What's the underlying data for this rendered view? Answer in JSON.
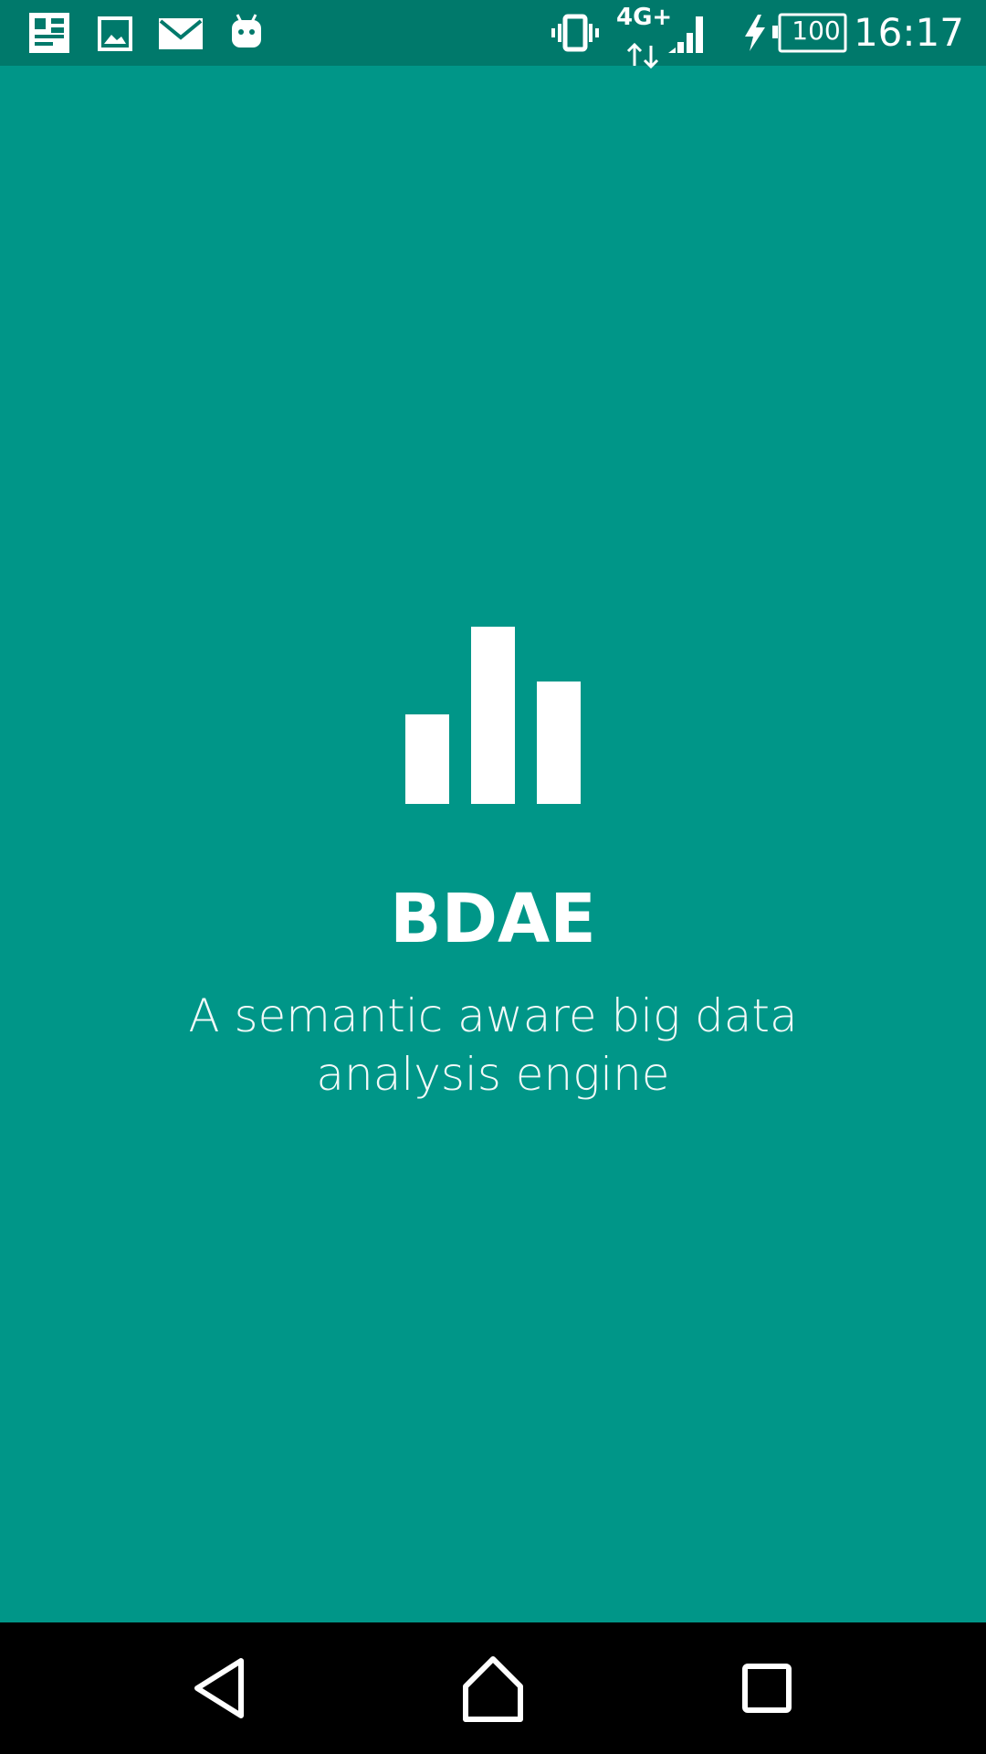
{
  "status_bar": {
    "time": "16:17",
    "battery_level": "100",
    "network_type": "4G+",
    "notification_icons": [
      "sim-card-icon",
      "image-icon",
      "mail-icon",
      "android-icon"
    ],
    "system_icons": [
      "vibrate-icon",
      "data-transfer-icon",
      "signal-icon",
      "charging-icon",
      "battery-icon"
    ]
  },
  "app": {
    "logo_icon": "bar-chart-icon",
    "title": "BDAE",
    "subtitle": "A semantic aware big data analysis engine"
  },
  "nav_bar": {
    "buttons": [
      "back-icon",
      "home-icon",
      "recents-icon"
    ]
  },
  "colors": {
    "primary": "#009688",
    "status_bar": "#00796B",
    "nav_bar": "#000000",
    "foreground": "#ffffff"
  }
}
